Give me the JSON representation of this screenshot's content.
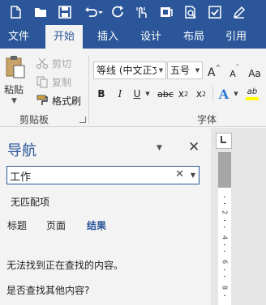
{
  "ribbon_tabs": [
    "文件",
    "开始",
    "插入",
    "设计",
    "布局",
    "引用"
  ],
  "active_tab": "开始",
  "clipboard": {
    "paste_label": "粘贴",
    "cut_label": "剪切",
    "copy_label": "复制",
    "format_painter_label": "格式刷",
    "group_label": "剪贴板"
  },
  "font": {
    "font_name": "等线 (中文正文",
    "font_size": "五号",
    "grow_label": "A",
    "shrink_label": "A",
    "bold": "B",
    "italic": "I",
    "underline": "U",
    "strikethrough": "abc",
    "subscript": "x",
    "subscript_sub": "2",
    "superscript": "x",
    "superscript_sup": "2",
    "text_effects": "A",
    "highlight": "ab",
    "group_label": "字体"
  },
  "navigation": {
    "title": "导航",
    "search_value": "工作",
    "no_match": "无匹配项",
    "tabs": [
      "标题",
      "页面",
      "结果"
    ],
    "active_tab": "结果",
    "message_not_found": "无法找到正在查找的内容。",
    "message_other": "是否查找其他内容?"
  },
  "ruler": {
    "numbers": [
      "2",
      "4",
      "6",
      "8"
    ]
  },
  "colors": {
    "brand": "#2b579a",
    "ribbon_bg": "#f3f3f3"
  },
  "icons": [
    "new-document-icon",
    "open-folder-icon",
    "save-icon",
    "undo-icon",
    "redo-icon",
    "touch-mode-icon",
    "open-file-icon",
    "print-preview-icon",
    "checkbox-icon",
    "edit-icon",
    "paste-icon",
    "scissors-icon",
    "copy-icon",
    "format-painter-icon"
  ]
}
